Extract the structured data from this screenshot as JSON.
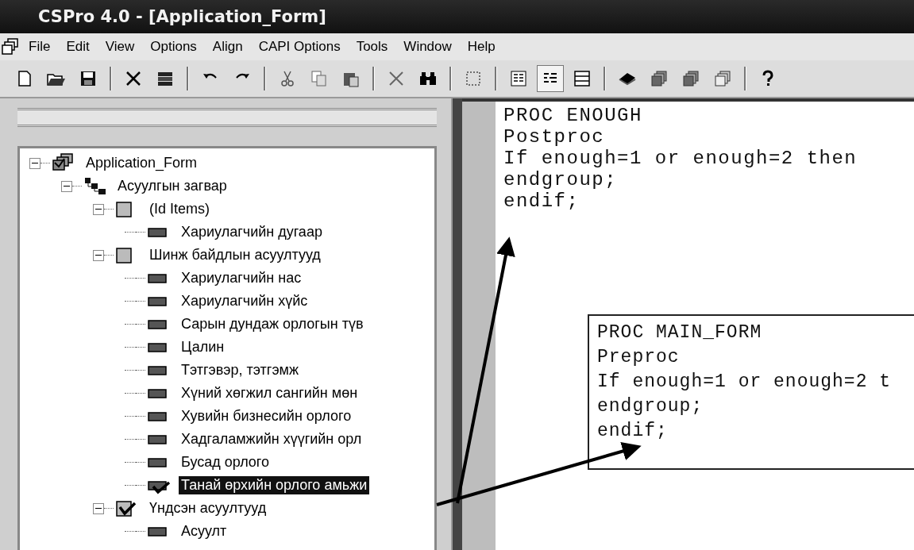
{
  "window": {
    "title": "CSPro 4.0 - [Application_Form]"
  },
  "menu": [
    "File",
    "Edit",
    "View",
    "Options",
    "Align",
    "CAPI Options",
    "Tools",
    "Window",
    "Help"
  ],
  "tree": [
    {
      "label": "Application_Form",
      "kind": "form",
      "selected": false,
      "children": [
        {
          "label": "Асуулгын загвар",
          "kind": "level",
          "selected": false,
          "children": [
            {
              "label": "(Id Items)",
              "kind": "record",
              "checked": false,
              "selected": false,
              "children": [
                {
                  "label": "Хариулагчийн дугаар",
                  "kind": "item",
                  "checked": false,
                  "selected": false
                }
              ]
            },
            {
              "label": "Шинж байдлын асуултууд",
              "kind": "record",
              "checked": false,
              "selected": false,
              "children": [
                {
                  "label": "Хариулагчийн нас",
                  "kind": "item",
                  "checked": false,
                  "selected": false
                },
                {
                  "label": "Хариулагчийн хүйс",
                  "kind": "item",
                  "checked": false,
                  "selected": false
                },
                {
                  "label": "Сарын дундаж орлогын түв",
                  "kind": "item",
                  "checked": false,
                  "selected": false
                },
                {
                  "label": "Цалин",
                  "kind": "item",
                  "checked": false,
                  "selected": false
                },
                {
                  "label": "Тэтгэвэр, тэтгэмж",
                  "kind": "item",
                  "checked": false,
                  "selected": false
                },
                {
                  "label": "Хүний хөгжил сангийн мөн",
                  "kind": "item",
                  "checked": false,
                  "selected": false
                },
                {
                  "label": "Хувийн бизнесийн орлого",
                  "kind": "item",
                  "checked": false,
                  "selected": false
                },
                {
                  "label": "Хадгаламжийн хүүгийн орл",
                  "kind": "item",
                  "checked": false,
                  "selected": false
                },
                {
                  "label": "Бусад орлого",
                  "kind": "item",
                  "checked": false,
                  "selected": false
                },
                {
                  "label": "Танай өрхийн орлого амьжи",
                  "kind": "item",
                  "checked": true,
                  "selected": true
                }
              ]
            },
            {
              "label": "Үндсэн асуултууд",
              "kind": "record",
              "checked": true,
              "selected": false,
              "children": [
                {
                  "label": "Асуулт",
                  "kind": "item",
                  "checked": false,
                  "selected": false
                }
              ]
            }
          ]
        }
      ]
    }
  ],
  "editor": {
    "lines": [
      "PROC ENOUGH",
      "Postproc",
      "If enough=1 or enough=2 then",
      "endgroup;",
      "endif;"
    ]
  },
  "callout": {
    "lines": [
      "PROC MAIN_FORM",
      "Preproc",
      "If enough=1 or enough=2 t",
      "endgroup;",
      "endif;"
    ]
  }
}
